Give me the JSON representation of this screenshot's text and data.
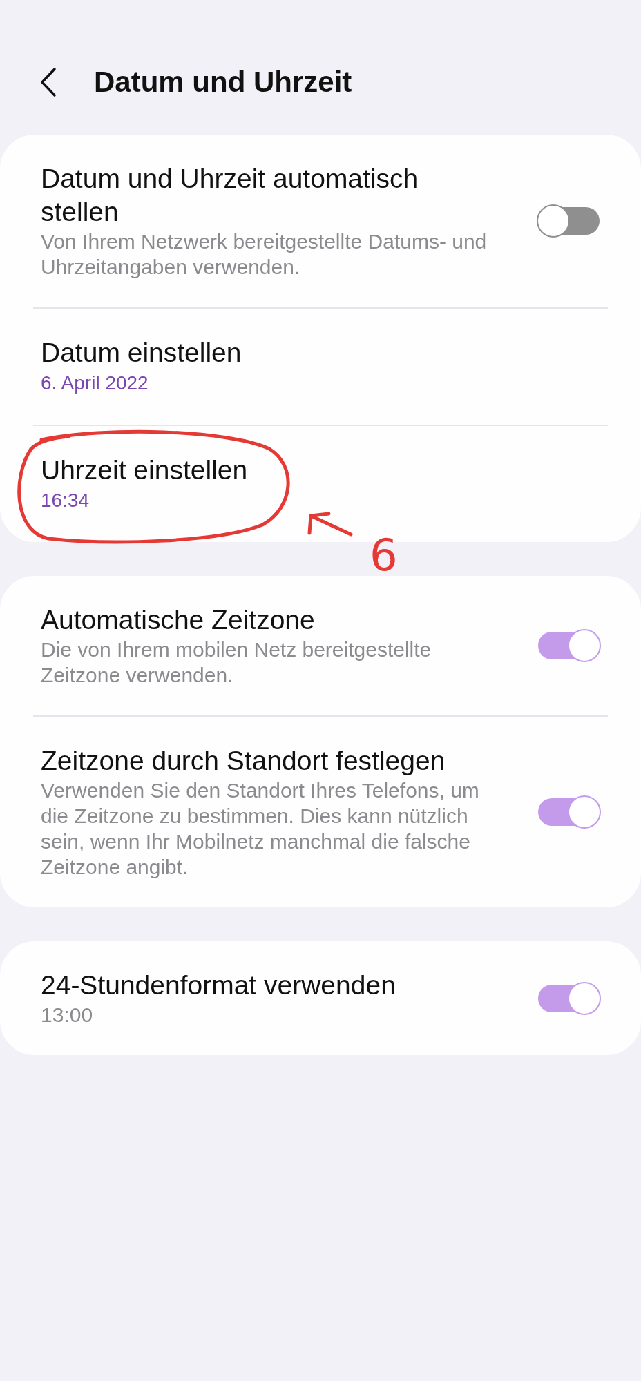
{
  "header": {
    "title": "Datum und Uhrzeit"
  },
  "cards": [
    {
      "rows": [
        {
          "kind": "toggle",
          "title": "Datum und Uhrzeit automatisch stellen",
          "subtitle": "Von Ihrem Netzwerk bereitgestellte Datums- und Uhrzeitangaben verwenden.",
          "on": false
        },
        {
          "kind": "value",
          "title": "Datum einstellen",
          "value": "6. April 2022"
        },
        {
          "kind": "value",
          "title": "Uhrzeit einstellen",
          "value": "16:34"
        }
      ]
    },
    {
      "rows": [
        {
          "kind": "toggle",
          "title": "Automatische Zeitzone",
          "subtitle": "Die von Ihrem mobilen Netz bereitgestellte Zeitzone verwenden.",
          "on": true
        },
        {
          "kind": "toggle",
          "title": "Zeitzone durch Standort festlegen",
          "subtitle": "Verwenden Sie den Standort Ihres Telefons, um die Zeitzone zu bestimmen. Dies kann nützlich sein, wenn Ihr Mobilnetz manchmal die falsche Zeitzone angibt.",
          "on": true
        }
      ]
    },
    {
      "rows": [
        {
          "kind": "toggle",
          "title": "24-Stundenformat verwenden",
          "subtitle": "13:00",
          "on": true
        }
      ]
    }
  ],
  "annotation": {
    "label": "6"
  }
}
